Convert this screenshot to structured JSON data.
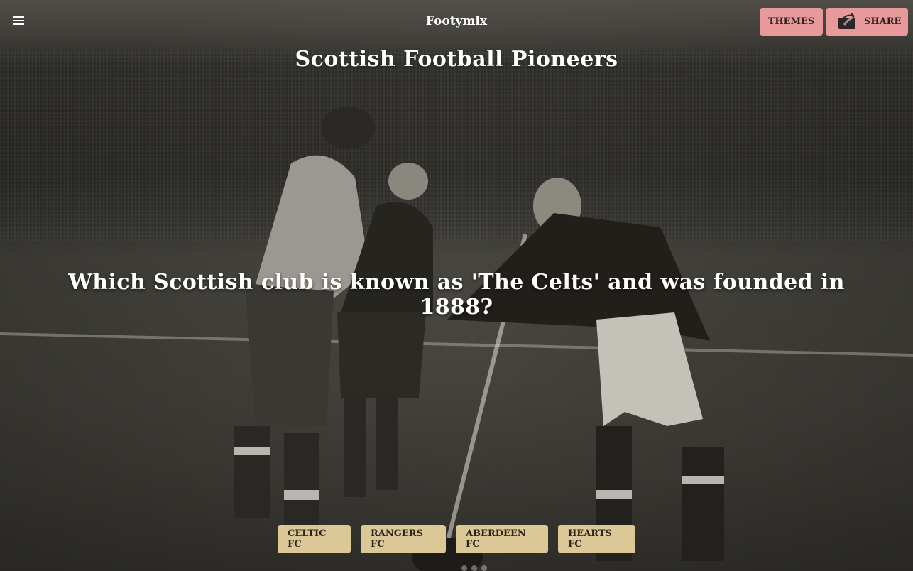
{
  "header": {
    "menu_icon": "hamburger-menu-icon",
    "app_title": "Footymix",
    "themes_label": "THEMES",
    "share_label": "SHARE",
    "share_icon": "share-icon",
    "button_color": "#e89a9a"
  },
  "quiz": {
    "title": "Scottish Football Pioneers",
    "question": "Which Scottish club is known as 'The Celts' and was founded in 1888?",
    "answers": [
      "CELTIC FC",
      "RANGERS FC",
      "ABERDEEN FC",
      "HEARTS FC"
    ],
    "answer_color": "#dcc897"
  },
  "background": {
    "description_color": "#45433d"
  }
}
